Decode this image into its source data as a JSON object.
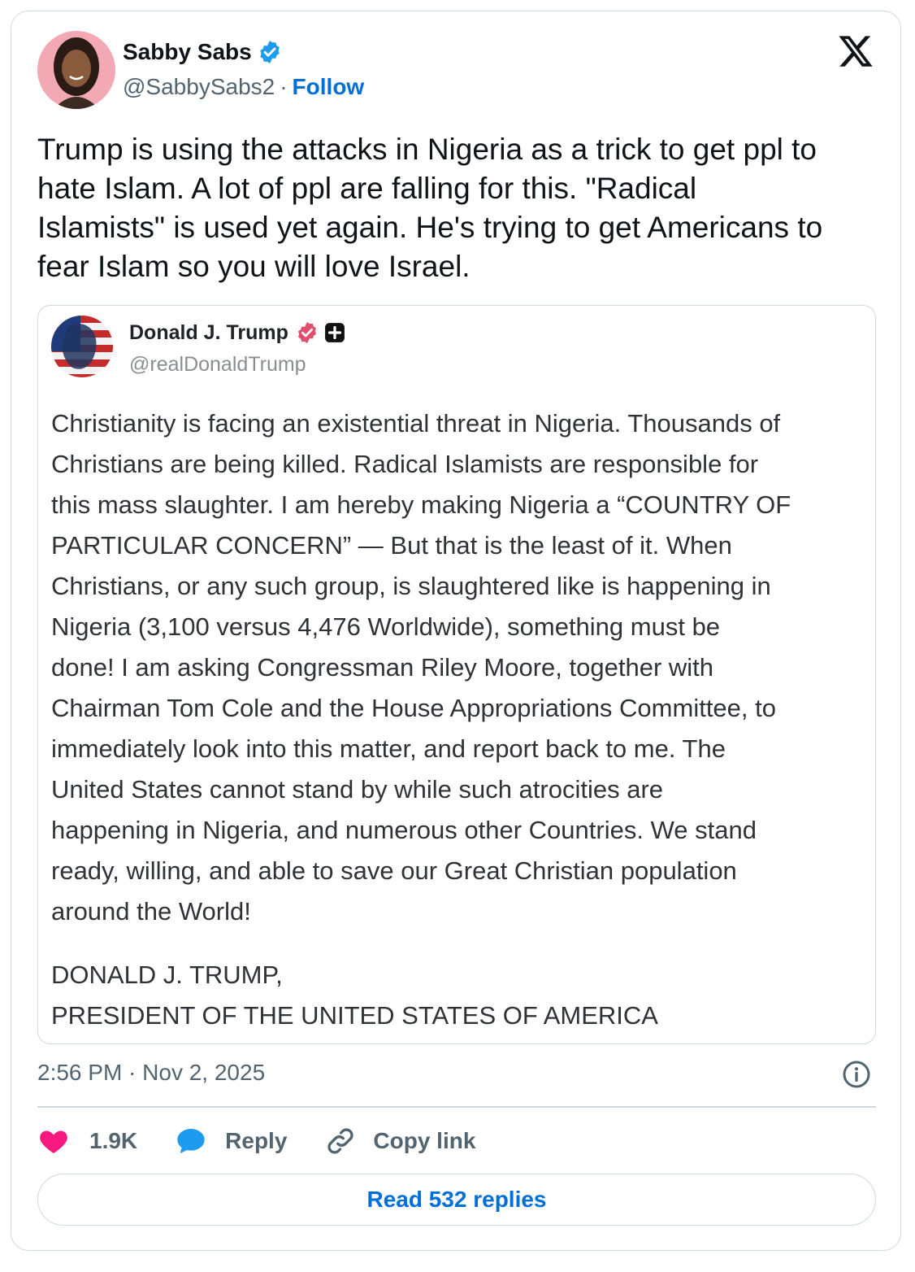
{
  "author": {
    "name": "Sabby Sabs",
    "handle": "@SabbySabs2",
    "separator": "·",
    "follow_label": "Follow",
    "avatar_icon": "profile-photo-icon"
  },
  "tweet": {
    "text": "Trump is using the attacks in Nigeria as a trick to get ppl to\nhate Islam. A lot of ppl are falling for this. \"Radical\nIslamists\" is used yet again. He's trying to get Americans to\nfear Islam so you will love Israel."
  },
  "quoted": {
    "name": "Donald J. Trump",
    "handle": "@realDonaldTrump",
    "body": "Christianity is facing an existential threat in Nigeria. Thousands of\nChristians are being killed. Radical Islamists are responsible for\nthis mass slaughter. I am hereby making Nigeria a “COUNTRY OF\nPARTICULAR CONCERN” — But that is the least of it. When\nChristians, or any such group, is slaughtered like is happening in\nNigeria (3,100 versus 4,476 Worldwide), something must be\ndone! I am asking Congressman Riley Moore, together with\nChairman Tom Cole and the House Appropriations Committee, to\nimmediately look into this matter, and report back to me. The\nUnited States cannot stand by while such atrocities are\nhappening in Nigeria, and numerous other Countries. We stand\nready, willing, and able to save our Great Christian population\naround the World!",
    "signature_line1": "DONALD J. TRUMP,",
    "signature_line2": "PRESIDENT OF THE UNITED STATES OF AMERICA"
  },
  "meta": {
    "timestamp": "2:56 PM · Nov 2, 2025"
  },
  "actions": {
    "likes": "1.9K",
    "reply_label": "Reply",
    "copy_label": "Copy link"
  },
  "read_replies_label": "Read 532 replies",
  "colors": {
    "accent": "#006fd6",
    "verified": "#1d9bf0",
    "like": "#f91880",
    "border": "#cfd9de",
    "secondary_text": "#536471"
  }
}
